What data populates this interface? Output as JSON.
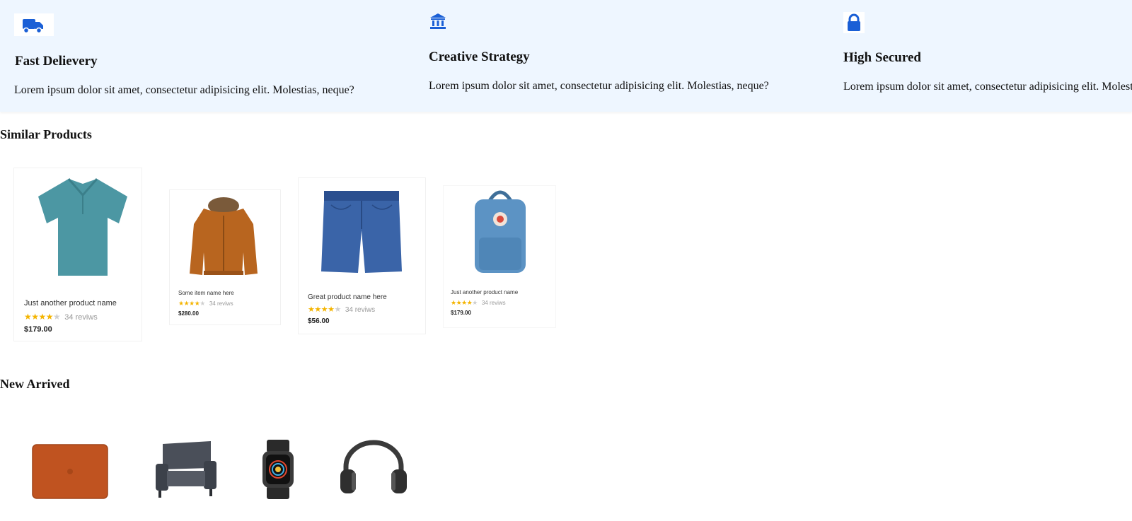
{
  "features": [
    {
      "icon": "truck-icon",
      "title": "Fast Delievery",
      "text": "Lorem ipsum dolor sit amet, consectetur adipisicing elit. Molestias, neque?"
    },
    {
      "icon": "bank-icon",
      "title": "Creative Strategy",
      "text": "Lorem ipsum dolor sit amet, consectetur adipisicing elit. Molestias, neque?"
    },
    {
      "icon": "lock-icon",
      "title": "High Secured",
      "text": "Lorem ipsum dolor sit amet, consectetur adipisicing elit. Molestias, neque?"
    }
  ],
  "similar": {
    "title": "Similar Products",
    "products": [
      {
        "name": "Just another product name",
        "rating": 4,
        "reviews": "34 reviws",
        "price": "$179.00",
        "image": "polo-shirt"
      },
      {
        "name": "Some item name here",
        "rating": 4,
        "reviews": "34 reviws",
        "price": "$280.00",
        "image": "jacket"
      },
      {
        "name": "Great product name here",
        "rating": 4,
        "reviews": "34 reviws",
        "price": "$56.00",
        "image": "denim-shorts"
      },
      {
        "name": "Just another product name",
        "rating": 4,
        "reviews": "34 reviws",
        "price": "$179.00",
        "image": "backpack"
      }
    ]
  },
  "new_arrived": {
    "title": "New Arrived",
    "items": [
      "laptop-sleeve",
      "armchair",
      "smartwatch",
      "headphones"
    ]
  },
  "colors": {
    "accent": "#1a5fd6",
    "band": "#eef6ff",
    "star": "#f4b400"
  }
}
